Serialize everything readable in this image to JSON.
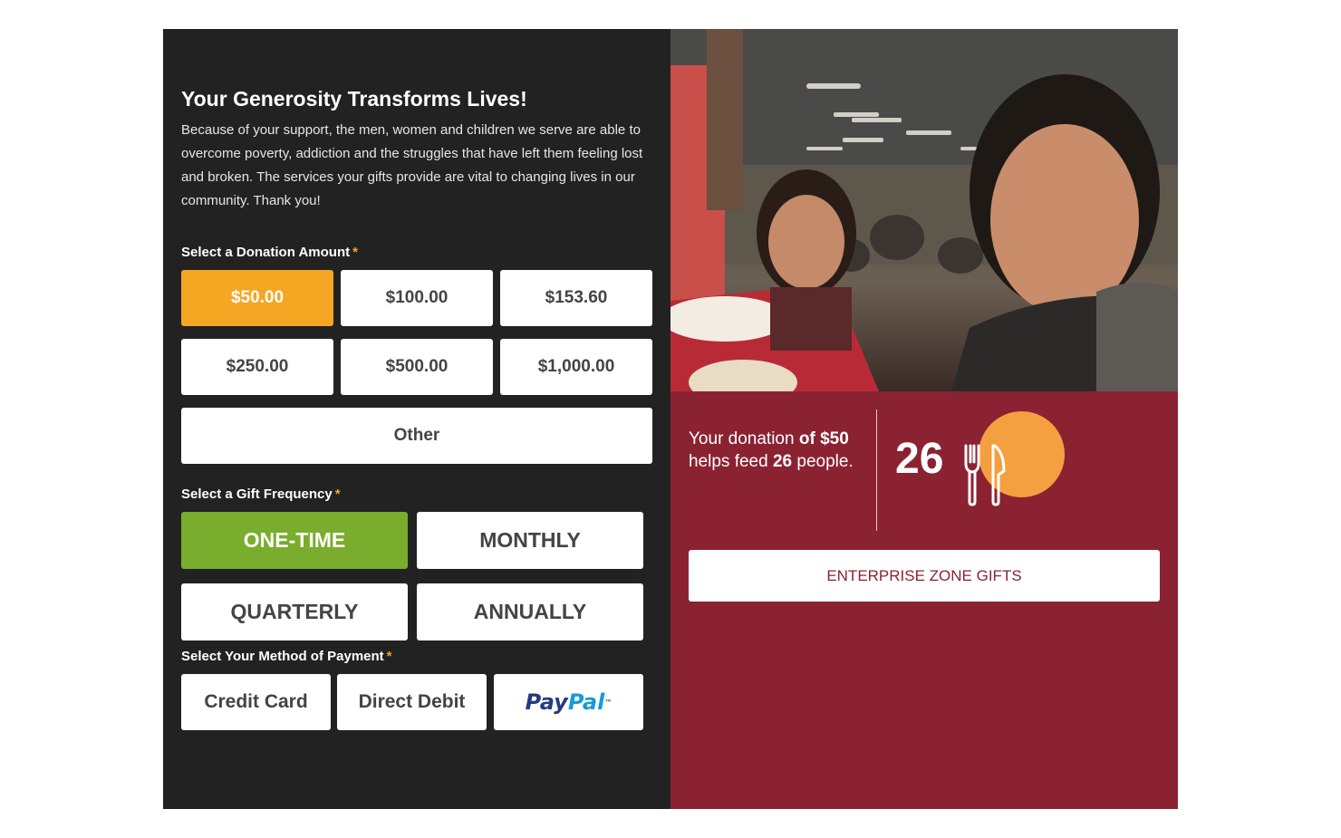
{
  "header": {
    "title": "Your Generosity Transforms Lives!",
    "intro": "Because of your support, the men, women and children we serve are able to overcome poverty, addiction and the struggles that have left them feeling lost and broken. The services your gifts provide are vital to changing lives in our community. Thank you!"
  },
  "donation": {
    "label": "Select a Donation Amount",
    "required": "*",
    "amounts": [
      "$50.00",
      "$100.00",
      "$153.60",
      "$250.00",
      "$500.00",
      "$1,000.00"
    ],
    "selected": "$50.00",
    "other_label": "Other"
  },
  "frequency": {
    "label": "Select a Gift Frequency",
    "required": "*",
    "options": [
      "ONE-TIME",
      "MONTHLY",
      "QUARTERLY",
      "ANNUALLY"
    ],
    "selected": "ONE-TIME"
  },
  "payment": {
    "label": "Select Your Method of Payment",
    "required": "*",
    "options": [
      "Credit Card",
      "Direct Debit"
    ],
    "paypal_part1": "Pay",
    "paypal_part2": "Pal",
    "paypal_tm": "™"
  },
  "impact": {
    "text_part1": "Your donation ",
    "text_bold1": "of $50",
    "text_part2": " helps feed ",
    "text_bold2": "26",
    "text_part3": " people.",
    "count": "26",
    "icon": "fork-knife-icon"
  },
  "cta": {
    "label": "ENTERPRISE ZONE GIFTS"
  },
  "colors": {
    "panel_dark": "#222222",
    "panel_red": "#8b2232",
    "accent_orange": "#f5a623",
    "accent_green": "#7aac2d",
    "circle_orange": "#f5a040"
  }
}
